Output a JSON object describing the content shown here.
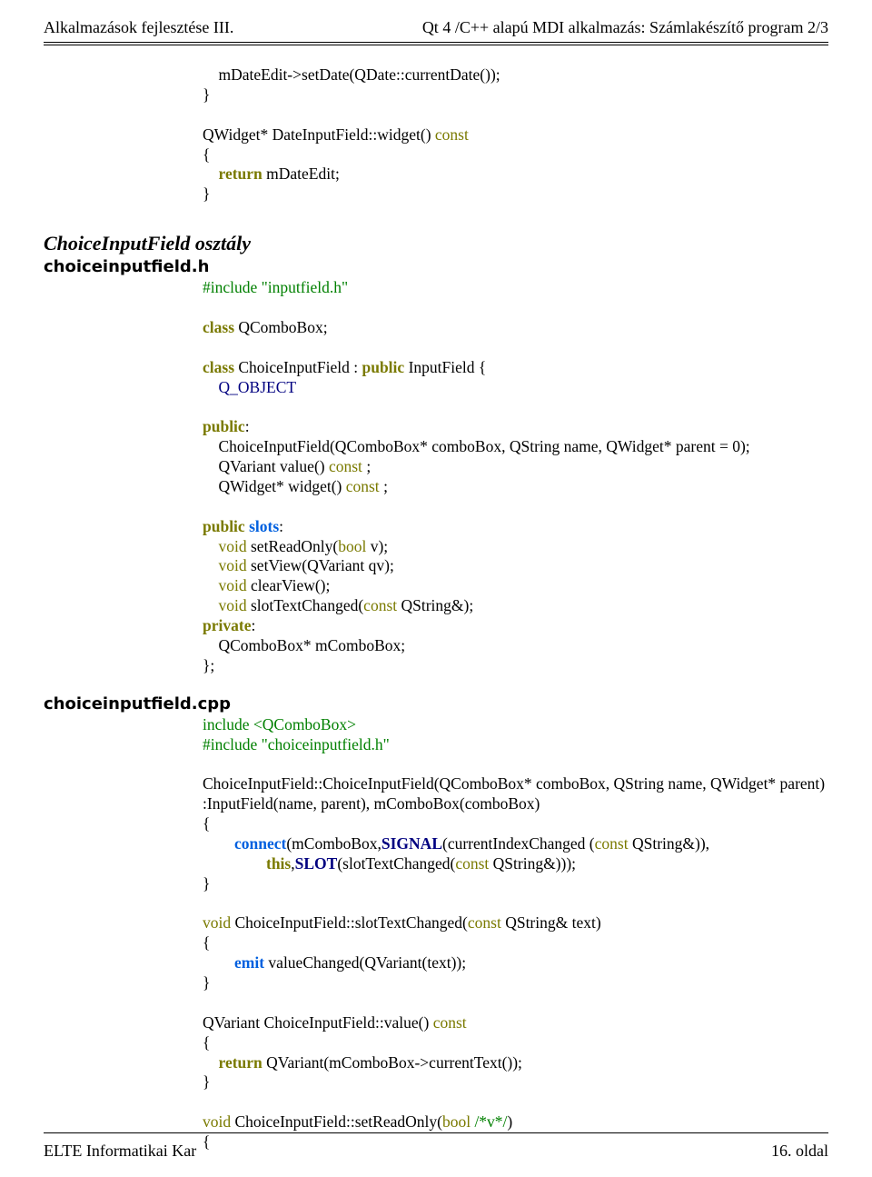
{
  "header": {
    "left": "Alkalmazások fejlesztése III.",
    "right": "Qt 4 /C++ alapú MDI alkalmazás: Számlakészítő program 2/3"
  },
  "footer": {
    "left": "ELTE Informatikai Kar",
    "right": "16. oldal"
  },
  "section": {
    "choice_class_heading": "ChoiceInputField osztály",
    "file_h": "choiceinputfield.h",
    "file_cpp": "choiceinputfield.cpp"
  },
  "code": {
    "top": {
      "l1_a": "    mDateEdit->setDate(QDate::currentDate());",
      "l2_a": "}",
      "l4_a": "QWidget* DateInputField::widget() ",
      "l4_b": "const",
      "l5_a": "{",
      "l6_a": "    ",
      "l6_b": "return",
      "l6_c": " mDateEdit;",
      "l7_a": "}"
    },
    "h": {
      "i1": "#include \"inputfield.h\"",
      "c1_a": "class",
      "c1_b": " QComboBox;",
      "c2_a": "class",
      "c2_b": " ChoiceInputField : ",
      "c2_c": "public",
      "c2_d": " InputField {",
      "qobj": "Q_OBJECT",
      "pub": "public",
      "pub_colon": ":",
      "ctor": "    ChoiceInputField(QComboBox* comboBox, QString name, QWidget* parent = 0);",
      "val_a": "    QVariant value() ",
      "val_b": "const",
      "val_c": " ;",
      "wid_a": "    QWidget* widget() ",
      "wid_b": "const",
      "wid_c": " ;",
      "pubsl_a": "public",
      "pubsl_b": " ",
      "pubsl_c": "slots",
      "pubsl_d": ":",
      "sr_a": "    ",
      "sr_b": "void",
      "sr_c": " setReadOnly(",
      "sr_d": "bool",
      "sr_e": " v);",
      "sv_a": "    ",
      "sv_b": "void",
      "sv_c": " setView(QVariant qv);",
      "cv_a": "    ",
      "cv_b": "void",
      "cv_c": " clearView();",
      "st_a": "    ",
      "st_b": "void",
      "st_c": " slotTextChanged(",
      "st_d": "const",
      "st_e": " QString&);",
      "priv_a": "private",
      "priv_b": ":",
      "mc": "    QComboBox* mComboBox;",
      "close": "};"
    },
    "cpp": {
      "inc1": "include <QComboBox>",
      "inc2": "#include \"choiceinputfield.h\"",
      "ctor1": "ChoiceInputField::ChoiceInputField(QComboBox* comboBox, QString name, QWidget* parent)",
      "ctor2": ":InputField(name, parent), mComboBox(comboBox)",
      "ob": "{",
      "conn_a": "        ",
      "conn_b": "connect",
      "conn_c": "(mComboBox,",
      "conn_d": "SIGNAL",
      "conn_e": "(currentIndexChanged (",
      "conn_f": "const",
      "conn_g": " QString&)),",
      "conn2_a": "                ",
      "conn2_b": "this",
      "conn2_c": ",",
      "conn2_d": "SLOT",
      "conn2_e": "(slotTextChanged(",
      "conn2_f": "const",
      "conn2_g": " QString&)));",
      "cb": "}",
      "stc_a": "void",
      "stc_b": " ChoiceInputField::slotTextChanged(",
      "stc_c": "const",
      "stc_d": " QString& text)",
      "stc_ob": "{",
      "stc_e_a": "        ",
      "stc_e_b": "emit",
      "stc_e_c": " valueChanged(QVariant(text));",
      "stc_cb": "}",
      "val_a": "QVariant ChoiceInputField::value() ",
      "val_b": "const",
      "val_ob": "{",
      "val_r_a": "    ",
      "val_r_b": "return",
      "val_r_c": " QVariant(mComboBox->currentText());",
      "val_cb": "}",
      "sro_a": "void",
      "sro_b": " ChoiceInputField::setReadOnly(",
      "sro_c": "bool",
      "sro_d": " ",
      "sro_e": "/*v*/",
      "sro_f": ")",
      "sro_ob": "{"
    }
  }
}
